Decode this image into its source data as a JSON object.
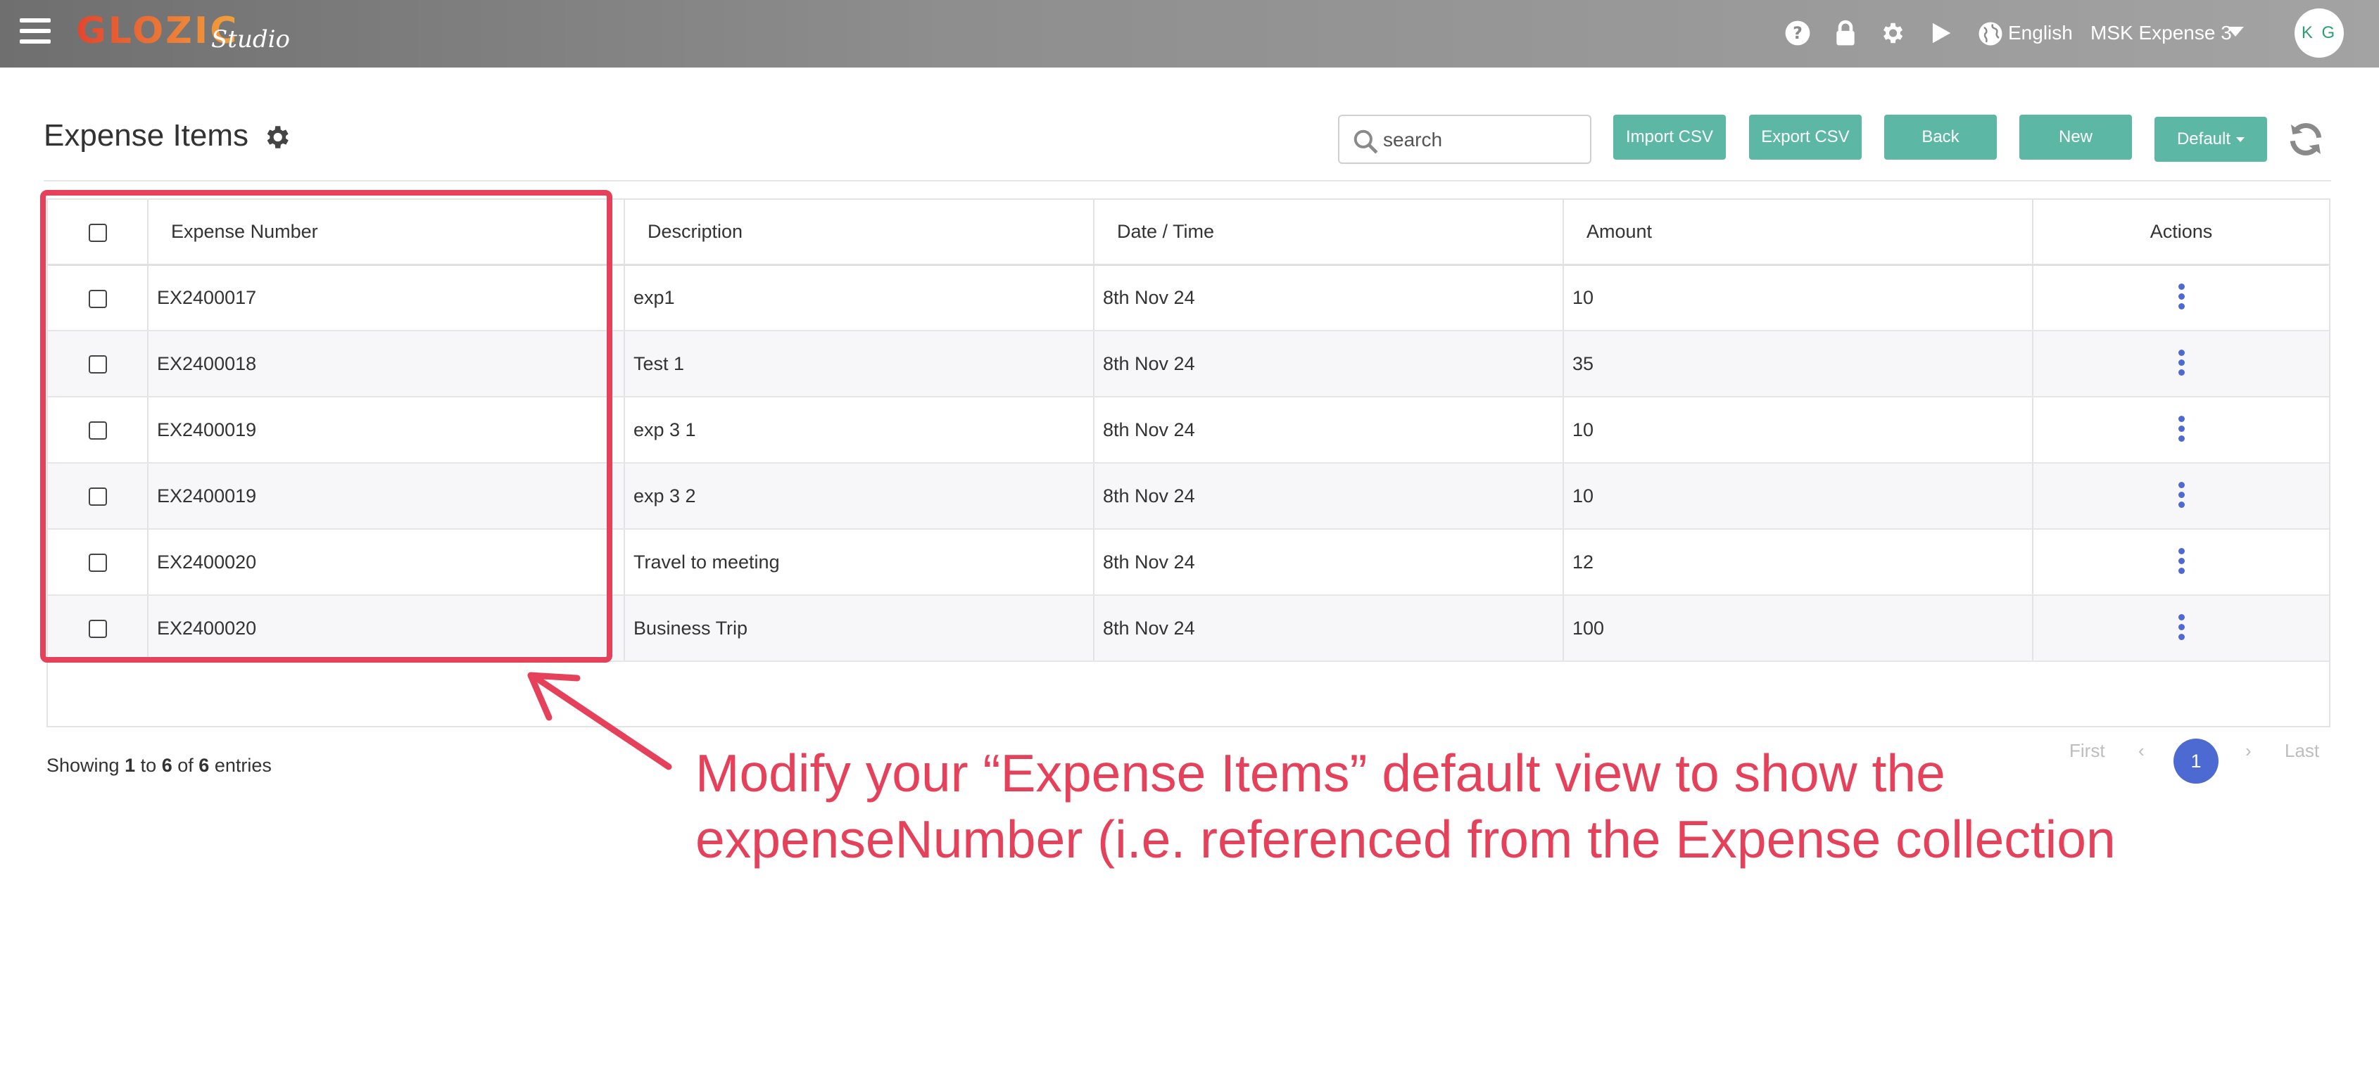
{
  "app": {
    "logo": "GLOZIC",
    "logo_sub": "Studio",
    "language": "English",
    "app_name": "MSK Expense 3",
    "user_initials": "K G",
    "icons": [
      "menu-icon",
      "help-icon",
      "lock-icon",
      "gear-icon",
      "play-icon",
      "globe-icon",
      "chevron-down-icon"
    ]
  },
  "page": {
    "title": "Expense Items",
    "search_placeholder": "search",
    "buttons": {
      "import_csv": "Import CSV",
      "export_csv": "Export CSV",
      "back": "Back",
      "new": "New",
      "default": "Default"
    }
  },
  "table": {
    "columns": [
      "Expense Number",
      "Description",
      "Date / Time",
      "Amount",
      "Actions"
    ],
    "rows": [
      {
        "expense_number": "EX2400017",
        "description": "exp1",
        "date": "8th Nov 24",
        "amount": "10"
      },
      {
        "expense_number": "EX2400018",
        "description": "Test 1",
        "date": "8th Nov 24",
        "amount": "35"
      },
      {
        "expense_number": "EX2400019",
        "description": "exp 3 1",
        "date": "8th Nov 24",
        "amount": "10"
      },
      {
        "expense_number": "EX2400019",
        "description": "exp 3 2",
        "date": "8th Nov 24",
        "amount": "10"
      },
      {
        "expense_number": "EX2400020",
        "description": "Travel to meeting",
        "date": "8th Nov 24",
        "amount": "12"
      },
      {
        "expense_number": "EX2400020",
        "description": "Business Trip",
        "date": "8th Nov 24",
        "amount": "100"
      }
    ]
  },
  "footer": {
    "showing": "Showing",
    "from": "1",
    "to_word": "to",
    "to": "6",
    "of_word": "of",
    "total": "6",
    "entries_word": "entries"
  },
  "pagination": {
    "first": "First",
    "prev": "‹",
    "current": "1",
    "next": "›",
    "last": "Last"
  },
  "annotation": {
    "line1": "Modify your “Expense Items” default view to show the",
    "line2": "expenseNumber (i.e. referenced from the Expense collection",
    "color": "#e5415a"
  },
  "colors": {
    "button": "#5cb8a5",
    "accent": "#4d6ad3",
    "annotation": "#e5415a"
  }
}
